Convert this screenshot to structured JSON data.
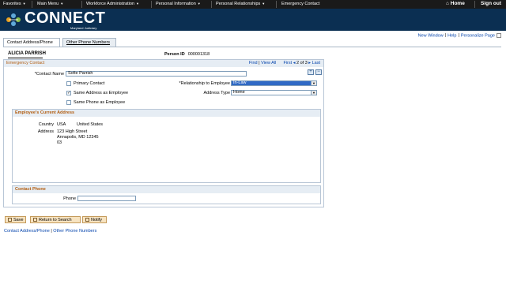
{
  "topnav": {
    "favorites": "Favorites",
    "main_menu": "Main Menu",
    "breadcrumbs": [
      "Workforce Administration",
      "Personal Information",
      "Personal Relationships",
      "Emergency Contact"
    ],
    "home": "Home",
    "sign_out": "Sign out"
  },
  "banner": {
    "logo_text": "CONNECT",
    "logo_sub": "Maryland Judiciary"
  },
  "toplinks": {
    "new_window": "New Window",
    "help": "Help",
    "personalize": "Personalize Page"
  },
  "tabs": [
    {
      "label": "Contact Address/Phone",
      "active": true
    },
    {
      "label": "Other Phone Numbers",
      "active": false
    }
  ],
  "employee": {
    "name": "ALICIA PARRISH",
    "person_id_label": "Person ID",
    "person_id": "000001318"
  },
  "panel": {
    "title": "Emergency Contact",
    "find": "Find",
    "view_all": "View All",
    "first": "First",
    "position": "2 of 3",
    "last": "Last"
  },
  "form": {
    "contact_name_label": "*Contact Name",
    "contact_name_value": "Sofie Parrish",
    "primary_contact_label": "Primary Contact",
    "primary_contact_checked": false,
    "same_address_label": "Same Address as Employee",
    "same_address_checked": true,
    "same_phone_label": "Same Phone as Employee",
    "same_phone_checked": false,
    "relationship_label": "*Relationship to Employee",
    "relationship_value": "In-Law",
    "address_type_label": "Address Type",
    "address_type_value": "Home"
  },
  "current_address": {
    "title": "Employee's Current Address",
    "country_label": "Country",
    "country_code": "USA",
    "country_name": "United States",
    "address_label": "Address",
    "address_line1": "123 High Street",
    "address_line2": "Annapolis, MD 12345",
    "address_line3": "03"
  },
  "contact_phone": {
    "title": "Contact Phone",
    "phone_label": "Phone",
    "phone_value": ""
  },
  "buttons": {
    "save": "Save",
    "return_to_search": "Return to Search",
    "notify": "Notify"
  },
  "bottomlinks": {
    "contact_address": "Contact Address/Phone",
    "other_phone": "Other Phone Numbers"
  },
  "colors": {
    "banner": "#0b2f52",
    "topnav": "#1a1a1a",
    "panel_title": "#b25d10",
    "link": "#0645ad",
    "highlight": "#316ac5"
  }
}
